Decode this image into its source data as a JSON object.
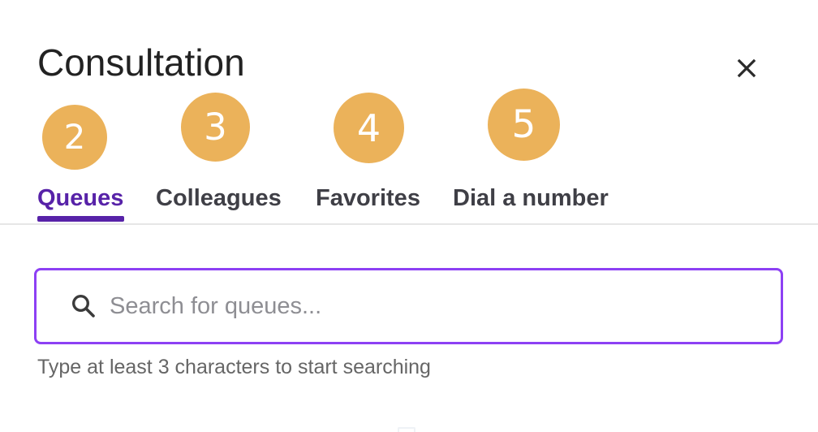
{
  "dialog": {
    "title": "Consultation",
    "close_icon": "close-icon"
  },
  "tabs": [
    {
      "label": "Queues",
      "badge": "2",
      "active": true
    },
    {
      "label": "Colleagues",
      "badge": "3",
      "active": false
    },
    {
      "label": "Favorites",
      "badge": "4",
      "active": false
    },
    {
      "label": "Dial a number",
      "badge": "5",
      "active": false
    }
  ],
  "search": {
    "icon": "search-icon",
    "placeholder": "Search for queues...",
    "value": "",
    "helper_text": "Type at least 3 characters to start searching"
  },
  "colors": {
    "accent": "#5722A8",
    "focus_border": "#8D40F4",
    "badge_background": "#EBB25A",
    "divider": "#E6E6E6"
  }
}
